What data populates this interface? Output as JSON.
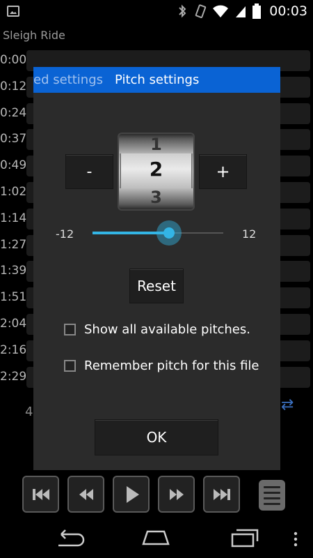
{
  "status_bar": {
    "time": "00:03",
    "icons": [
      "image-icon",
      "bluetooth-icon",
      "vibrate-icon",
      "wifi-icon",
      "signal-icon",
      "battery-icon"
    ]
  },
  "player": {
    "song_title": "Sleigh Ride",
    "times": [
      "0:00",
      "0:12",
      "0:24",
      "0:37",
      "0:49",
      "1:02",
      "1:14",
      "1:27",
      "1:39",
      "1:51",
      "2:04",
      "2:16",
      "2:29"
    ],
    "partial_label": "4"
  },
  "dialog": {
    "tab_previous": "ed settings",
    "tab_active": "Pitch settings",
    "minus_label": "-",
    "plus_label": "+",
    "picker": {
      "above": "1",
      "selected": "2",
      "below": "3"
    },
    "slider": {
      "min_label": "-12",
      "max_label": "12",
      "value": 2
    },
    "reset_label": "Reset",
    "checkbox_all_pitches": "Show all available pitches.",
    "checkbox_remember": "Remember pitch for this file",
    "ok_label": "OK"
  },
  "colors": {
    "accent": "#33b5e5",
    "tab_bar": "#0a63d4",
    "dialog_bg": "#2b2b2b"
  }
}
